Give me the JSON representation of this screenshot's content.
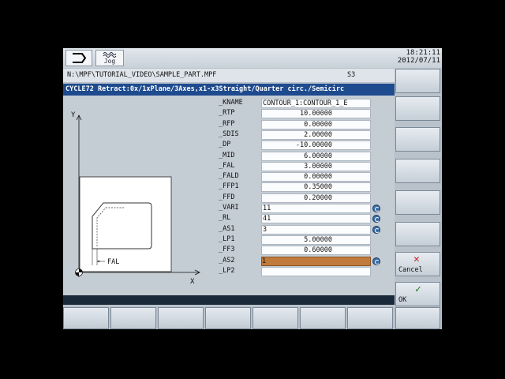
{
  "header": {
    "mode_icon": "mode-arrow-icon",
    "jog_icon": "jog-wave-icon",
    "jog_label": "Jog",
    "time": "18:21:11",
    "date": "2012/07/11"
  },
  "path": "N:\\MPF\\TUTORIAL_VIDEO\\SAMPLE_PART.MPF",
  "channel": "S3",
  "cycle_title": "CYCLE72 Retract:0x/1xPlane/3Axes,x1-x3Straight/Quarter circ./Semicirc",
  "graphic": {
    "axis_y": "Y",
    "axis_x": "X",
    "dim_label": "FAL"
  },
  "params": [
    {
      "label": "_KNAME",
      "value": "CONTOUR_1:CONTOUR_1_E",
      "type": "txt"
    },
    {
      "label": "_RTP",
      "value": "10.00000",
      "type": "num"
    },
    {
      "label": "_RFP",
      "value": "0.00000",
      "type": "num"
    },
    {
      "label": "_SDIS",
      "value": "2.00000",
      "type": "num"
    },
    {
      "label": "_DP",
      "value": "-10.00000",
      "type": "num"
    },
    {
      "label": "_MID",
      "value": "6.00000",
      "type": "num"
    },
    {
      "label": "_FAL",
      "value": "3.00000",
      "type": "num"
    },
    {
      "label": "_FALD",
      "value": "0.00000",
      "type": "num"
    },
    {
      "label": "_FFP1",
      "value": "0.35000",
      "type": "num"
    },
    {
      "label": "_FFD",
      "value": "0.20000",
      "type": "num"
    },
    {
      "label": "_VARI",
      "value": "11",
      "type": "txt",
      "toggle": true
    },
    {
      "label": "_RL",
      "value": "41",
      "type": "txt",
      "toggle": true
    },
    {
      "label": "_AS1",
      "value": "3",
      "type": "txt",
      "toggle": true
    },
    {
      "label": "_LP1",
      "value": "5.00000",
      "type": "num"
    },
    {
      "label": "_FF3",
      "value": "0.60000",
      "type": "num"
    },
    {
      "label": "_AS2",
      "value": "1",
      "type": "sel",
      "toggle": true
    },
    {
      "label": "_LP2",
      "value": "",
      "type": "num"
    }
  ],
  "softkeys": {
    "cancel_label": "Cancel",
    "cancel_icon": "cross-icon",
    "ok_label": "OK",
    "ok_icon": "checkmark-icon"
  },
  "colors": {
    "title_bar": "#1e4b8e",
    "selected_field": "#c07a3c",
    "cancel_glyph": "#c0202a",
    "ok_glyph": "#1c7a2a"
  }
}
